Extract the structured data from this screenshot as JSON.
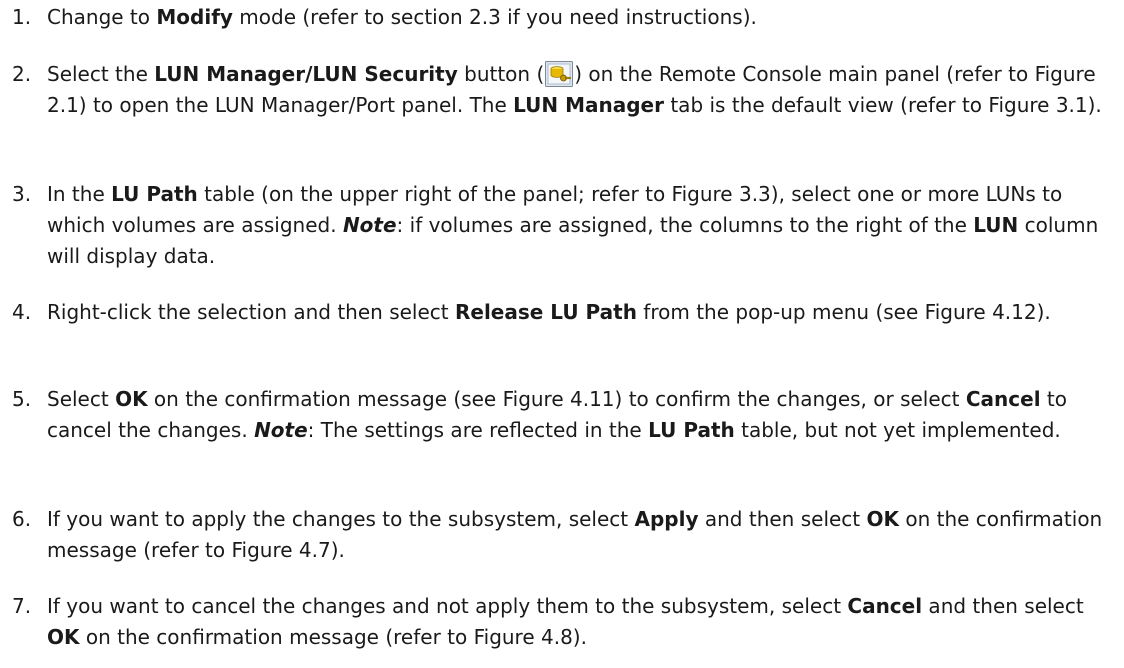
{
  "steps": [
    {
      "number": "1.",
      "segments": [
        {
          "t": "Change to "
        },
        {
          "t": "Modify",
          "b": true
        },
        {
          "t": " mode (refer to section 2.3 if you need instructions)."
        }
      ]
    },
    {
      "number": "2.",
      "segments": [
        {
          "t": "Select the "
        },
        {
          "t": "LUN Manager/LUN Security",
          "b": true
        },
        {
          "t": " button ("
        },
        {
          "icon": "lun-manager-icon"
        },
        {
          "t": ") on the Remote Console main panel (refer to Figure 2.1) to open the LUN Manager/Port panel. The "
        },
        {
          "t": "LUN Manager",
          "b": true
        },
        {
          "t": " tab is the default view (refer to Figure 3.1)."
        }
      ]
    },
    {
      "number": "3.",
      "segments": [
        {
          "t": "In the "
        },
        {
          "t": "LU Path",
          "b": true
        },
        {
          "t": " table (on the upper right of the panel; refer to Figure 3.3), select one or more LUNs to which volumes are assigned. "
        },
        {
          "t": "Note",
          "note": true
        },
        {
          "t": ": if volumes are assigned, the columns to the right of the "
        },
        {
          "t": "LUN",
          "b": true
        },
        {
          "t": " column will display data."
        }
      ]
    },
    {
      "number": "4.",
      "segments": [
        {
          "t": "Right-click the selection and then select "
        },
        {
          "t": "Release LU Path",
          "b": true
        },
        {
          "t": " from the pop-up menu (see Figure 4.12)."
        }
      ]
    },
    {
      "number": "5.",
      "segments": [
        {
          "t": "Select "
        },
        {
          "t": "OK",
          "b": true
        },
        {
          "t": " on the confirmation message (see Figure 4.11) to confirm the changes, or select "
        },
        {
          "t": "Cancel",
          "b": true
        },
        {
          "t": " to cancel the changes. "
        },
        {
          "t": "Note",
          "note": true
        },
        {
          "t": ": The settings are reflected in the "
        },
        {
          "t": "LU Path",
          "b": true
        },
        {
          "t": " table, but not yet implemented."
        }
      ]
    },
    {
      "number": "6.",
      "segments": [
        {
          "t": "If you want to apply the changes to the subsystem, select "
        },
        {
          "t": "Apply",
          "b": true
        },
        {
          "t": " and then select "
        },
        {
          "t": "OK",
          "b": true
        },
        {
          "t": " on the confirmation message (refer to Figure 4.7)."
        }
      ]
    },
    {
      "number": "7.",
      "segments": [
        {
          "t": "If you want to cancel the changes and not apply them to the subsystem, select "
        },
        {
          "t": "Cancel",
          "b": true
        },
        {
          "t": " and then select "
        },
        {
          "t": "OK",
          "b": true
        },
        {
          "t": " on the confirmation message (refer to Figure 4.8)."
        }
      ]
    }
  ],
  "colors": {
    "text": "#1a1a1a",
    "icon_gold": "#e8b800",
    "icon_frame": "#7a8a99"
  }
}
